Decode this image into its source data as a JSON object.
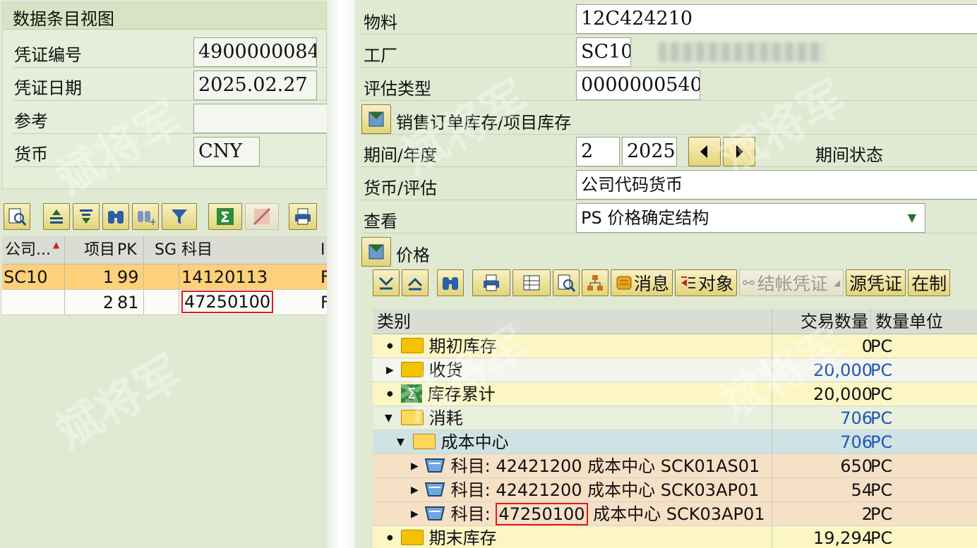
{
  "left": {
    "title": "数据条目视图",
    "fields": [
      {
        "label": "凭证编号",
        "value": "4900000084"
      },
      {
        "label": "凭证日期",
        "value": "2025.02.27"
      },
      {
        "label": "参考",
        "value": ""
      },
      {
        "label": "货币",
        "value": "CNY"
      }
    ],
    "grid": {
      "headers": [
        "公司...",
        "项目",
        "PK",
        "SG",
        "科目",
        "I"
      ],
      "rows": [
        {
          "company": "SC10",
          "item": "1",
          "pk": "99",
          "sg": "",
          "account": "14120113",
          "extra": "F"
        },
        {
          "company": "",
          "item": "2",
          "pk": "81",
          "sg": "",
          "account": "47250100",
          "extra": "F"
        }
      ]
    }
  },
  "right": {
    "material_label": "物料",
    "material_value": "12C424210",
    "plant_label": "工厂",
    "plant_value": "SC10",
    "val_type_label": "评估类型",
    "val_type_value": "0000000540",
    "sales_stock_label": "销售订单库存/项目库存",
    "period_label": "期间/年度",
    "period_value": "2",
    "year_value": "2025",
    "period_status_label": "期间状态",
    "currency_label": "货币/评估",
    "currency_value": "公司代码货币",
    "view_label": "查看",
    "view_value": "PS 价格确定结构",
    "price_label": "价格",
    "toolbar": {
      "messages": "消息",
      "object": "对象",
      "closing_doc": "结帐凭证",
      "source_doc": "源凭证",
      "more": "在制"
    },
    "tree": {
      "headers": {
        "category": "类别",
        "qty": "交易数量",
        "unit": "数量单位"
      },
      "rows": [
        {
          "label": "期初库存",
          "qty": "0",
          "unit": "PC"
        },
        {
          "label": "收货",
          "qty": "20,000",
          "unit": "PC"
        },
        {
          "label": "库存累计",
          "qty": "20,000",
          "unit": "PC"
        },
        {
          "label": "消耗",
          "qty": "706",
          "unit": "PC"
        },
        {
          "label": "成本中心",
          "qty": "706",
          "unit": "PC"
        },
        {
          "label_prefix": "科目:",
          "account": "42421200",
          "label_suffix": "成本中心 SCK01AS01",
          "qty": "650",
          "unit": "PC"
        },
        {
          "label_prefix": "科目:",
          "account": "42421200",
          "label_suffix": "成本中心 SCK03AP01",
          "qty": "54",
          "unit": "PC"
        },
        {
          "label_prefix": "科目:",
          "account": "47250100",
          "label_suffix": "成本中心 SCK03AP01",
          "qty": "2",
          "unit": "PC"
        },
        {
          "label": "期末库存",
          "qty": "19,294",
          "unit": "PC"
        }
      ]
    }
  },
  "watermark_text": "斌将军",
  "colors": {
    "accent_row": "#ffd07a",
    "highlight_box": "#e0191c",
    "blue_qty": "#1f55b8"
  }
}
